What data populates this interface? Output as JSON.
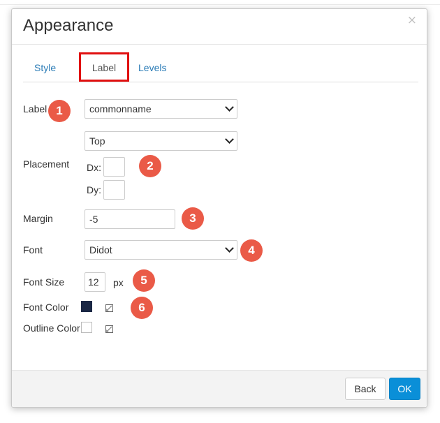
{
  "dialog": {
    "title": "Appearance",
    "close_glyph": "×"
  },
  "tabs": [
    {
      "label": "Style",
      "active": false
    },
    {
      "label": "Label",
      "active": true
    },
    {
      "label": "Levels",
      "active": false
    }
  ],
  "form": {
    "label_field": {
      "label": "Label",
      "value": "commonname"
    },
    "placement": {
      "label": "Placement",
      "value": "Top",
      "dx_label": "Dx:",
      "dx_value": "",
      "dy_label": "Dy:",
      "dy_value": ""
    },
    "margin": {
      "label": "Margin",
      "value": "-5"
    },
    "font": {
      "label": "Font",
      "value": "Didot"
    },
    "font_size": {
      "label": "Font Size",
      "value": "12",
      "unit": "px"
    },
    "font_color": {
      "label": "Font Color",
      "color": "#1a2744"
    },
    "outline_color": {
      "label": "Outline Color",
      "color": "#ffffff"
    }
  },
  "annotations": [
    "1",
    "2",
    "3",
    "4",
    "5",
    "6"
  ],
  "footer": {
    "back_label": "Back",
    "ok_label": "OK"
  },
  "colors": {
    "accent": "#0a8fd8",
    "badge": "#ea5a47",
    "tab_highlight": "#e01010",
    "link": "#2a7bb6"
  }
}
